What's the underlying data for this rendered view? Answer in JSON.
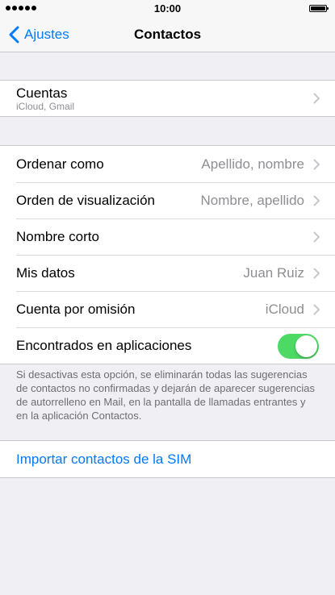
{
  "status_bar": {
    "time": "10:00"
  },
  "nav": {
    "back_label": "Ajustes",
    "title": "Contactos"
  },
  "accounts": {
    "title": "Cuentas",
    "subtitle": "iCloud, Gmail"
  },
  "settings": {
    "sort_label": "Ordenar como",
    "sort_value": "Apellido, nombre",
    "display_label": "Orden de visualización",
    "display_value": "Nombre, apellido",
    "short_name_label": "Nombre corto",
    "my_info_label": "Mis datos",
    "my_info_value": "Juan Ruiz",
    "default_account_label": "Cuenta por omisión",
    "default_account_value": "iCloud",
    "found_in_apps_label": "Encontrados en aplicaciones",
    "found_in_apps_on": true
  },
  "footer_note": "Si desactivas esta opción, se eliminarán todas las sugerencias de contactos no confirmadas y dejarán de aparecer sugerencias de autorrelleno en Mail, en la pantalla de llamadas entrantes y en la aplicación Contactos.",
  "import": {
    "label": "Importar contactos de la SIM"
  },
  "colors": {
    "accent": "#007aff",
    "toggle_on": "#4cd964",
    "background": "#efeff4"
  }
}
